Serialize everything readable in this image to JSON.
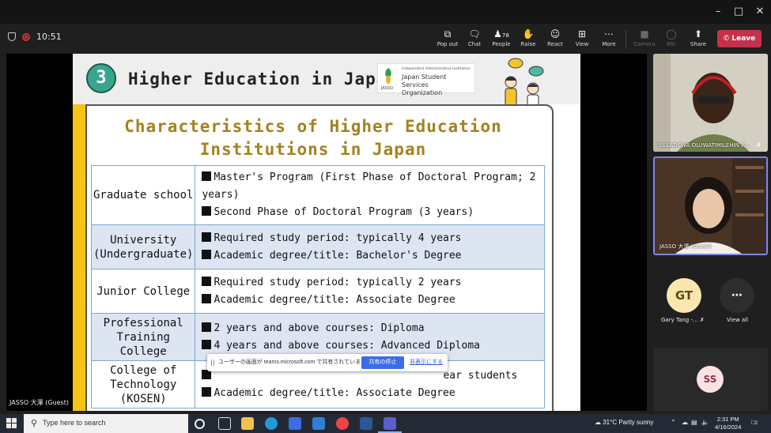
{
  "toolbar": {
    "time": "10:51",
    "buttons": [
      {
        "label": "Pop out",
        "icon": "pop-out-icon"
      },
      {
        "label": "Chat",
        "icon": "chat-icon"
      },
      {
        "label": "People",
        "icon": "people-icon",
        "count": "78"
      },
      {
        "label": "Raise",
        "icon": "raise-hand-icon"
      },
      {
        "label": "React",
        "icon": "react-icon"
      },
      {
        "label": "View",
        "icon": "view-icon"
      },
      {
        "label": "More",
        "icon": "more-icon"
      },
      {
        "label": "Camera",
        "icon": "camera-off-icon"
      },
      {
        "label": "Mic",
        "icon": "mic-off-icon"
      },
      {
        "label": "Share",
        "icon": "share-icon"
      }
    ],
    "leave_label": "Leave",
    "leave_color": "#c4314b"
  },
  "slide": {
    "number": "3",
    "title": "Higher Education in Japan",
    "logo": {
      "line1": "Independent Administrative Institution",
      "line2": "Japan Student Services",
      "line3": "Organization",
      "abbr": "JASSO"
    },
    "heading_line1": "Characteristics of Higher Education",
    "heading_line2": "Institutions in Japan",
    "rows": [
      {
        "category": [
          "Graduate school"
        ],
        "details": [
          "Master's Program (First Phase of Doctoral Program; 2 years)",
          "Second Phase of Doctoral Program (3 years)"
        ]
      },
      {
        "category": [
          "University",
          "(Undergraduate)"
        ],
        "details": [
          "Required study period: typically 4 years",
          "Academic degree/title: Bachelor's Degree"
        ]
      },
      {
        "category": [
          "Junior College"
        ],
        "details": [
          "Required study period: typically 2 years",
          "Academic degree/title: Associate Degree"
        ]
      },
      {
        "category": [
          "Professional",
          "Training",
          "College"
        ],
        "details": [
          "2 years and above courses: Diploma",
          "4 years and above courses: Advanced Diploma"
        ]
      },
      {
        "category": [
          "College of",
          "Technology",
          "(KOSEN)"
        ],
        "details": [
          "ear students",
          "Academic degree/title: Associate Degree"
        ]
      }
    ],
    "accent_color": "#a3821e"
  },
  "share_bar": {
    "message": "ユーザーの画面が teams.microsoft.com で共有されています。",
    "stop_label": "共有の停止",
    "hide_label": "非表示にする"
  },
  "stage_label": "JASSO 大澤 (Guest)",
  "participants": {
    "tile1_name": "ILELADEWA OLUWATIMILEHIN A...",
    "tile2_name": "JASSO 大澤 (Guest)",
    "avatar1": {
      "initials": "GT",
      "name": "Gary Tang -..."
    },
    "view_all_label": "View all",
    "avatar3": {
      "initials": "SS"
    }
  },
  "taskbar": {
    "search_placeholder": "Type here to search",
    "weather": "31°C  Partly sunny",
    "time": "2:31 PM",
    "date": "4/16/2024",
    "notification_count": "2"
  }
}
